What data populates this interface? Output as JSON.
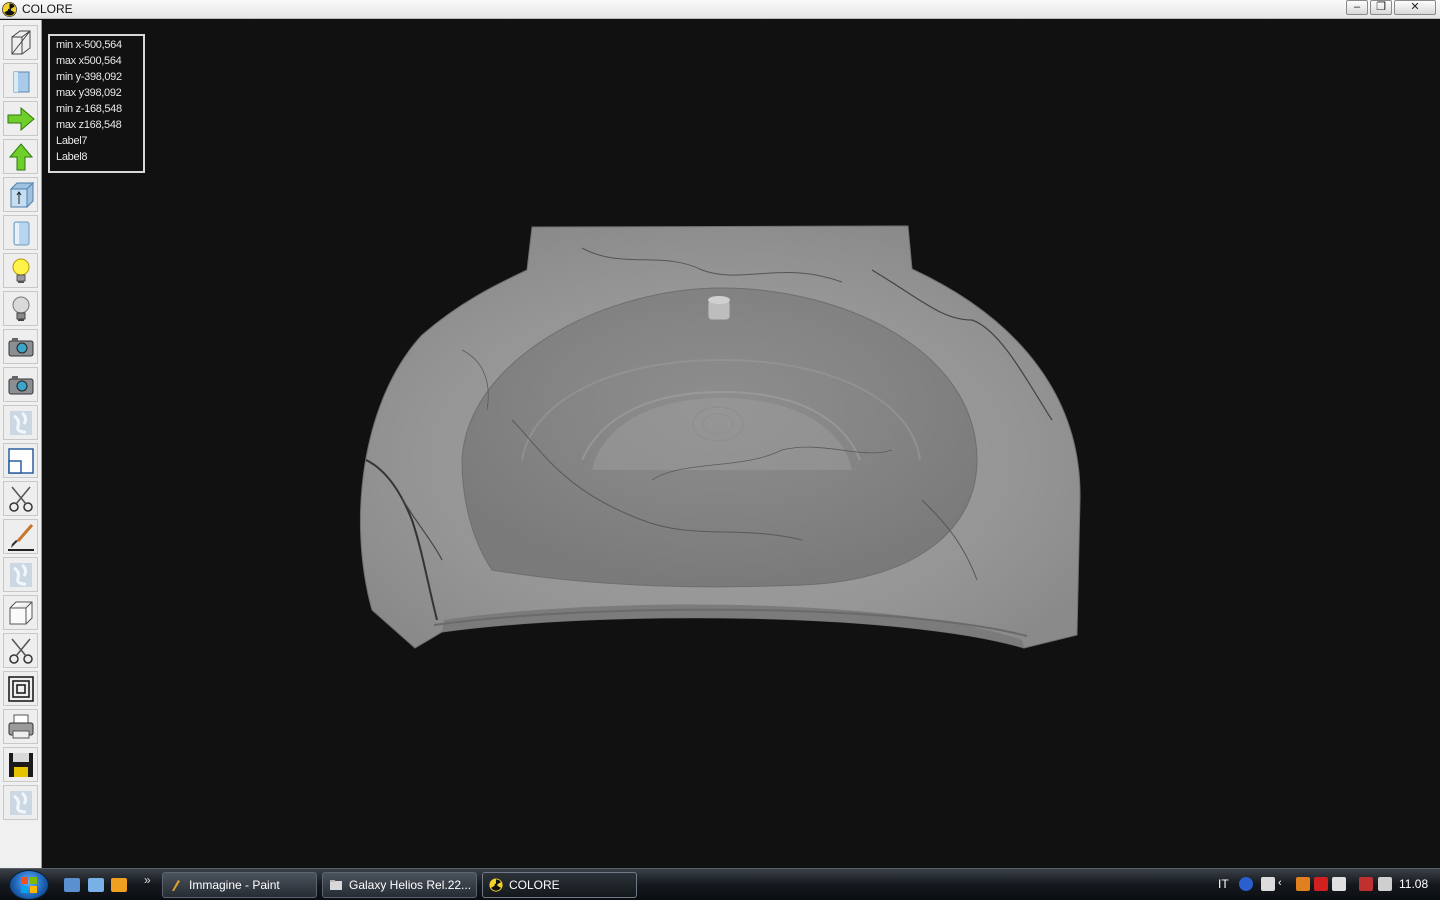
{
  "window": {
    "title": "COLORE",
    "minimize": "–",
    "restore": "❐",
    "close": "✕"
  },
  "toolbar": {
    "tools": [
      {
        "name": "wireframe-icon"
      },
      {
        "name": "solid-view-icon"
      },
      {
        "name": "arrow-right-icon"
      },
      {
        "name": "arrow-up-icon"
      },
      {
        "name": "extrude-icon"
      },
      {
        "name": "cylinder-icon"
      },
      {
        "name": "light-on-icon"
      },
      {
        "name": "light-off-icon"
      },
      {
        "name": "camera-icon"
      },
      {
        "name": "camera-2-icon"
      },
      {
        "name": "texture-icon"
      },
      {
        "name": "window-layout-icon"
      },
      {
        "name": "scissors-icon"
      },
      {
        "name": "paint-brush-icon"
      },
      {
        "name": "texture-2-icon"
      },
      {
        "name": "cube-icon"
      },
      {
        "name": "scissors-2-icon"
      },
      {
        "name": "nested-squares-icon"
      },
      {
        "name": "printer-icon"
      },
      {
        "name": "save-icon"
      },
      {
        "name": "texture-3-icon"
      }
    ]
  },
  "info": {
    "lines": [
      "min x-500,564",
      "max x500,564",
      "min y-398,092",
      "max y398,092",
      "min z-168,548",
      "max z168,548",
      "Label7",
      "Label8"
    ]
  },
  "taskbar": {
    "tasks": [
      {
        "label": "Immagine - Paint"
      },
      {
        "label": "Galaxy Helios  Rel.22..."
      },
      {
        "label": "COLORE"
      }
    ],
    "chevron": "»",
    "lang": "IT",
    "clock": "11.08"
  },
  "colors": {
    "viewport_bg": "#111111",
    "marble_base": "#9b9b9b",
    "marble_vein": "#3a3a3a"
  }
}
